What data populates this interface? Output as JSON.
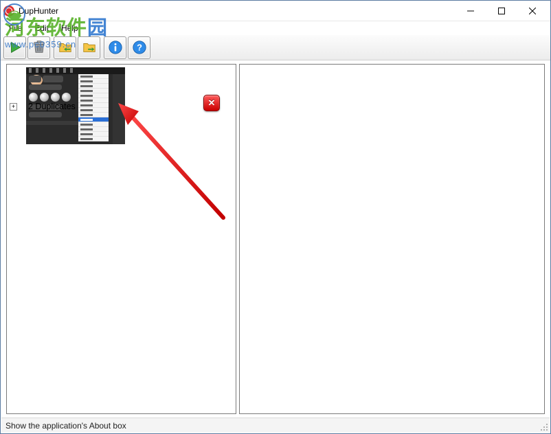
{
  "window": {
    "title": "DupHunter"
  },
  "menu": {
    "file": "File",
    "edit": "Edit",
    "help": "Help"
  },
  "toolbar_icons": {
    "play": "play-icon",
    "trash": "trash-icon",
    "folder_import": "folder-import-icon",
    "folder_export": "folder-export-icon",
    "info": "info-icon",
    "help": "help-icon"
  },
  "tree": {
    "node_label": "2 Duplicates"
  },
  "delete": {
    "tooltip": "Delete"
  },
  "statusbar": {
    "text": "Show the application's About box"
  },
  "watermark": {
    "cn_a": "河东软件",
    "cn_b": "园",
    "url": "www.pc0359.cn"
  }
}
